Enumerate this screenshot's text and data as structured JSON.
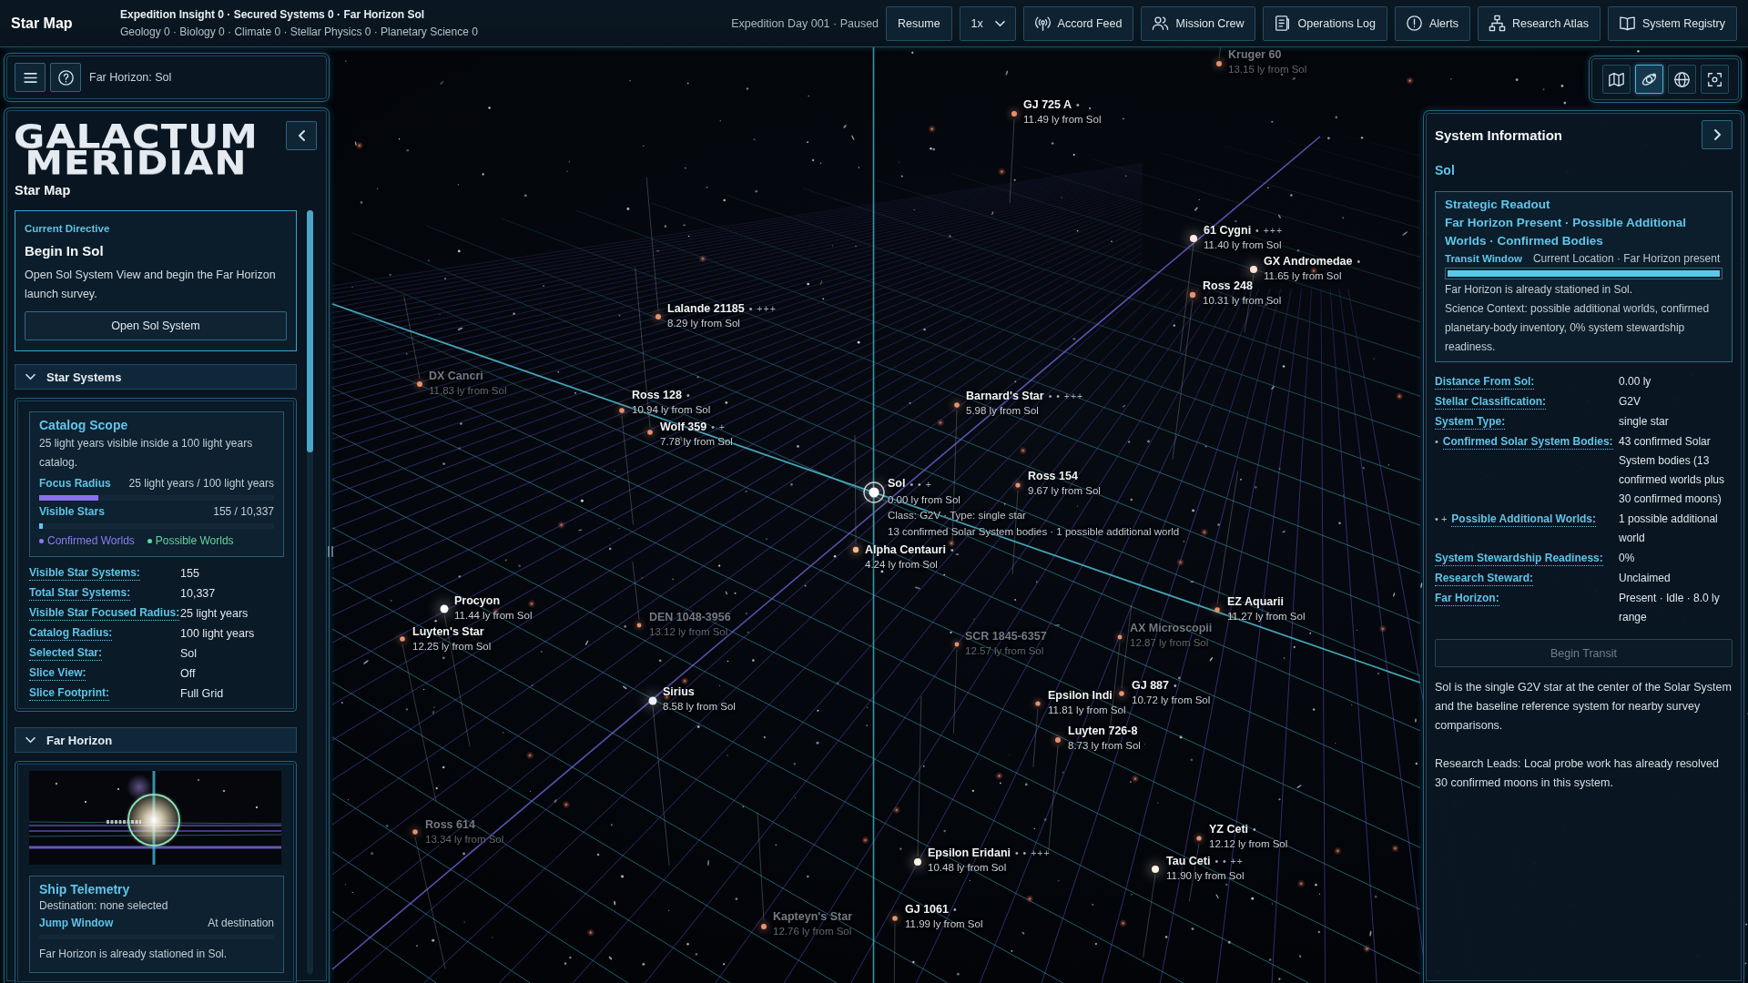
{
  "top_bar": {
    "title": "Star Map",
    "summary": "Expedition Insight 0 · Secured Systems 0 · Far Horizon Sol",
    "disciplines": "Geology 0 · Biology 0 · Climate 0 · Stellar Physics 0 · Planetary Science 0",
    "status": "Expedition Day 001 · Paused",
    "resume": "Resume",
    "speed": "1x",
    "nav": [
      {
        "label": "Accord Feed",
        "kind": "broadcast"
      },
      {
        "label": "Mission Crew",
        "kind": "crew"
      },
      {
        "label": "Operations Log",
        "kind": "log"
      },
      {
        "label": "Alerts",
        "kind": "alert"
      },
      {
        "label": "Research Atlas",
        "kind": "atlas"
      },
      {
        "label": "System Registry",
        "kind": "registry"
      }
    ]
  },
  "location_bar": {
    "location": "Far Horizon: Sol"
  },
  "sidebar": {
    "logo": [
      "GALACTUM",
      "MERIDIAN"
    ],
    "title": "Star Map",
    "directive": {
      "label": "Current Directive",
      "title": "Begin In Sol",
      "text": "Open Sol System View and begin the Far Horizon launch survey.",
      "button": "Open Sol System"
    },
    "star_systems": {
      "title": "Star Systems",
      "expanded": true,
      "catalog": {
        "title": "Catalog Scope",
        "text": "25 light years visible inside a 100 light years catalog.",
        "meters": [
          {
            "label": "Focus Radius",
            "reading": "25 light years / 100 light years",
            "level": 0.25,
            "color": "#8a6ff0"
          },
          {
            "label": "Visible Stars",
            "reading": "155 / 10,337",
            "level": 0.015,
            "color": "#5cc8f0"
          }
        ],
        "legend": [
          {
            "label": "Confirmed Worlds",
            "color": "#8d7cf2"
          },
          {
            "label": "Possible Worlds",
            "color": "#62d69c"
          }
        ]
      },
      "facts": [
        {
          "label": "Visible Star Systems:",
          "value": "155"
        },
        {
          "label": "Total Star Systems:",
          "value": "10,337"
        },
        {
          "label": "Visible Star Focused Radius:",
          "value": "25 light years"
        },
        {
          "label": "Catalog Radius:",
          "value": "100 light years"
        },
        {
          "label": "Selected Star:",
          "value": "Sol"
        },
        {
          "label": "Slice View:",
          "value": "Off"
        },
        {
          "label": "Slice Footprint:",
          "value": "Full Grid"
        }
      ]
    },
    "far_horizon": {
      "title": "Far Horizon",
      "expanded": true,
      "telemetry": {
        "title": "Ship Telemetry",
        "destination": "Destination: none selected",
        "label": "Jump Window",
        "reading": "At destination",
        "text": "Far Horizon is already stationed in Sol."
      }
    }
  },
  "map": {
    "stars": [
      {
        "name": "Kruger 60",
        "distance": "13.15 ly from Sol",
        "dim": true,
        "selected": false,
        "color": "#e8906f"
      },
      {
        "name": "GJ 725 A",
        "marks": "•",
        "distance": "11.49 ly from Sol",
        "dim": false,
        "selected": false,
        "color": "#e8906f"
      },
      {
        "name": "61 Cygni",
        "marks": "• +++",
        "distance": "11.40 ly from Sol",
        "dim": false,
        "selected": false,
        "color": "#ffe9dc"
      },
      {
        "name": "Lalande 21185",
        "marks": "• +++",
        "distance": "8.29 ly from Sol",
        "dim": false,
        "selected": false,
        "color": "#e8906f"
      },
      {
        "name": "Ross 248",
        "distance": "10.31 ly from Sol",
        "dim": false,
        "selected": false,
        "color": "#e8906f"
      },
      {
        "name": "GX Andromedae",
        "marks": "•",
        "distance": "11.65 ly from Sol",
        "dim": false,
        "selected": false,
        "color": "#ffe0d6"
      },
      {
        "name": "DX Cancri",
        "distance": "11.83 ly from Sol",
        "dim": true,
        "selected": false,
        "color": "#e8906f"
      },
      {
        "name": "Ross 128",
        "marks": "•",
        "distance": "10.94 ly from Sol",
        "dim": false,
        "selected": false,
        "color": "#e8906f"
      },
      {
        "name": "Barnard's Star",
        "marks": "• • +++",
        "distance": "5.98 ly from Sol",
        "dim": false,
        "selected": false,
        "color": "#e8906f"
      },
      {
        "name": "Wolf 359",
        "marks": "• +",
        "distance": "7.78 ly from Sol",
        "dim": false,
        "selected": false,
        "color": "#e8906f"
      },
      {
        "name": "Sol",
        "marks": "• • +",
        "distance": "0.00 ly from Sol",
        "details": [
          "Class: G2V · Type: single star",
          "13 confirmed Solar System bodies · 1 possible additional world"
        ],
        "dim": false,
        "selected": true,
        "color": "#ffffff"
      },
      {
        "name": "Ross 154",
        "distance": "9.67 ly from Sol",
        "dim": false,
        "selected": false,
        "color": "#e8906f"
      },
      {
        "name": "Alpha Centauri",
        "marks": "•",
        "distance": "4.24 ly from Sol",
        "dim": false,
        "selected": false,
        "color": "#f5b889"
      },
      {
        "name": "Procyon",
        "distance": "11.44 ly from Sol",
        "dim": false,
        "selected": false,
        "color": "#ffffff"
      },
      {
        "name": "Luyten's Star",
        "distance": "12.25 ly from Sol",
        "dim": false,
        "selected": false,
        "color": "#e8906f"
      },
      {
        "name": "DEN 1048-3956",
        "distance": "13.12 ly from Sol",
        "dim": true,
        "selected": false,
        "color": "#e8906f"
      },
      {
        "name": "SCR 1845-6357",
        "distance": "12.57 ly from Sol",
        "dim": true,
        "selected": false,
        "color": "#e8906f"
      },
      {
        "name": "AX Microscopii",
        "distance": "12.87 ly from Sol",
        "dim": true,
        "selected": false,
        "color": "#e8906f"
      },
      {
        "name": "EZ Aquarii",
        "distance": "11.27 ly from Sol",
        "dim": false,
        "selected": false,
        "color": "#e8906f"
      },
      {
        "name": "Sirius",
        "distance": "8.58 ly from Sol",
        "dim": false,
        "selected": false,
        "color": "#e8f2ff"
      },
      {
        "name": "Epsilon Indi",
        "distance": "11.81 ly from Sol",
        "dim": false,
        "selected": false,
        "color": "#e8906f"
      },
      {
        "name": "GJ 887",
        "marks": "•",
        "distance": "10.72 ly from Sol",
        "dim": false,
        "selected": false,
        "color": "#e8906f"
      },
      {
        "name": "Luyten 726-8",
        "distance": "8.73 ly from Sol",
        "dim": false,
        "selected": false,
        "color": "#e8906f"
      },
      {
        "name": "Ross 614",
        "distance": "13.34 ly from Sol",
        "dim": true,
        "selected": false,
        "color": "#e8906f"
      },
      {
        "name": "Epsilon Eridani",
        "marks": "• • +++",
        "distance": "10.48 ly from Sol",
        "dim": false,
        "selected": false,
        "color": "#fff1e0"
      },
      {
        "name": "YZ Ceti",
        "marks": "•",
        "distance": "12.12 ly from Sol",
        "dim": false,
        "selected": false,
        "color": "#e8906f"
      },
      {
        "name": "Tau Ceti",
        "marks": "• • ++",
        "distance": "11.90 ly from Sol",
        "dim": false,
        "selected": false,
        "color": "#fff1e0"
      },
      {
        "name": "Kapteyn's Star",
        "distance": "12.76 ly from Sol",
        "dim": true,
        "selected": false,
        "color": "#e8906f"
      },
      {
        "name": "GJ 1061",
        "marks": "•",
        "distance": "11.99 ly from Sol",
        "dim": false,
        "selected": false,
        "color": "#e8906f"
      }
    ]
  },
  "view_tools": [
    {
      "kind": "map",
      "selected": false
    },
    {
      "kind": "orbit",
      "selected": true
    },
    {
      "kind": "globe",
      "selected": false
    },
    {
      "kind": "focus",
      "selected": false
    }
  ],
  "system_info": {
    "title": "System Information",
    "system": "Sol",
    "readout": {
      "title": "Strategic Readout",
      "flags": "Far Horizon Present · Possible Additional Worlds · Confirmed Bodies",
      "window_label": "Transit Window",
      "window_status": "Current Location · Far Horizon present",
      "level": 1,
      "notes": [
        "Far Horizon is already stationed in Sol.",
        "Science Context: possible additional worlds, confirmed planetary-body inventory, 0% system stewardship readiness."
      ]
    },
    "facts": [
      {
        "label": "Distance From Sol:",
        "value": "0.00 ly"
      },
      {
        "label": "Stellar Classification:",
        "value": "G2V"
      },
      {
        "label": "System Type:",
        "value": "single star"
      },
      {
        "marker": "•",
        "label": "Confirmed Solar System Bodies:",
        "value": "43 confirmed Solar System bodies (13 confirmed worlds plus 30 confirmed moons)"
      },
      {
        "marker": "• +",
        "label": "Possible Additional Worlds:",
        "value": "1 possible additional world"
      },
      {
        "label": "System Stewardship Readiness:",
        "value": "0%"
      },
      {
        "label": "Research Steward:",
        "value": "Unclaimed"
      },
      {
        "label": "Far Horizon:",
        "value": "Present · Idle · 8.0 ly range"
      }
    ],
    "action": {
      "label": "Begin Transit",
      "disabled": true
    },
    "paragraphs": [
      "Sol is the single G2V star at the center of the Solar System and the baseline reference system for nearby survey comparisons.",
      "Research Leads: Local probe work has already resolved 30 confirmed moons in this system."
    ]
  }
}
